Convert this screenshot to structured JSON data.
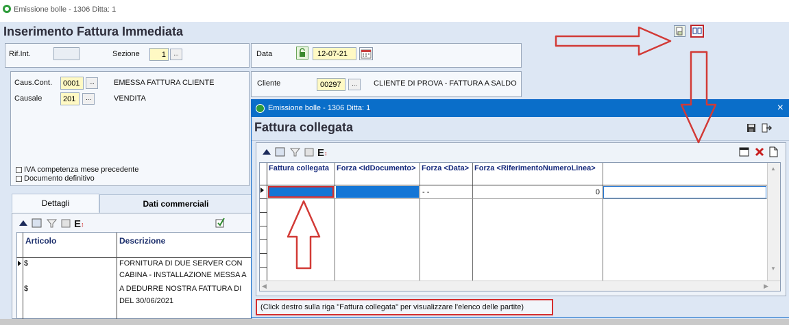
{
  "main_window": {
    "title": "Emissione bolle - 1306   Ditta: 1",
    "heading": "Inserimento Fattura Immediata"
  },
  "header": {
    "rif_int_label": "Rif.Int.",
    "rif_int_value": "",
    "sezione_label": "Sezione",
    "sezione_value": "1",
    "data_label": "Data",
    "data_value": "12-07-21"
  },
  "causali": {
    "caus_cont_label": "Caus.Cont.",
    "caus_cont_code": "0001",
    "caus_cont_desc": "EMESSA FATTURA CLIENTE",
    "causale_label": "Causale",
    "causale_code": "201",
    "causale_desc": "VENDITA",
    "iva_checkbox": "IVA competenza mese precedente",
    "definitivo_checkbox": "Documento definitivo"
  },
  "cliente": {
    "label": "Cliente",
    "code": "00297",
    "desc": "CLIENTE DI PROVA - FATTURA A SALDO"
  },
  "tabs": [
    {
      "label": "Dettagli"
    },
    {
      "label": "Dati commerciali"
    }
  ],
  "detail_grid": {
    "columns": [
      "Articolo",
      "Descrizione"
    ],
    "rows": [
      {
        "articolo": "$",
        "descrizione": "FORNITURA DI DUE SERVER CON"
      },
      {
        "articolo": "",
        "descrizione": "CABINA - INSTALLAZIONE MESSA A"
      },
      {
        "articolo": "$",
        "descrizione": "A DEDURRE NOSTRA FATTURA DI"
      },
      {
        "articolo": "",
        "descrizione": "DEL 30/06/2021"
      }
    ]
  },
  "popup": {
    "title": "Emissione bolle - 1306   Ditta: 1",
    "heading": "Fattura collegata",
    "close": "×",
    "columns": [
      "Fattura collegata",
      "Forza <IdDocumento>",
      "Forza <Data>",
      "Forza <RiferimentoNumeroLinea>"
    ],
    "row": {
      "fattura_collegata": "",
      "id_documento": "",
      "data": "- -",
      "riferimento": "0"
    },
    "hint": "(Click destro sulla riga \"Fattura collegata\" per visualizzare l'elenco delle partite)"
  },
  "colors": {
    "window_bg": "#dde7f4",
    "popup_titlebar": "#0a6ec9",
    "annotation_red": "#d23a36",
    "selection_blue": "#1476d6"
  }
}
